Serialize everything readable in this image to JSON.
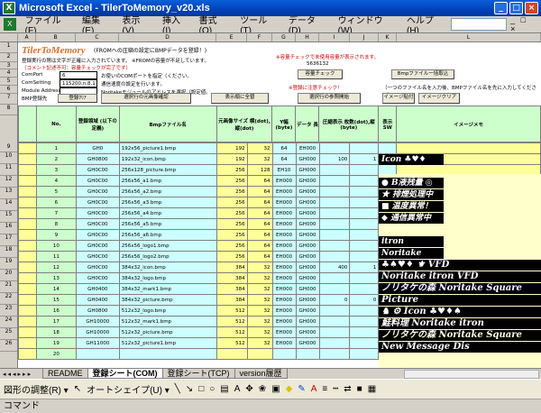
{
  "window": {
    "title": "Microsoft Excel - TilerToMemory_v20.xls",
    "app_icon": "excel-icon",
    "minimize": "_",
    "maximize": "□",
    "close": "×"
  },
  "menu": [
    "ファイル(F)",
    "編集(E)",
    "表示(V)",
    "挿入(I)",
    "書式(O)",
    "ツール(T)",
    "データ(D)",
    "ウィンドウ(W)",
    "ヘルプ(H)"
  ],
  "columns": [
    "",
    "A",
    "B",
    "C",
    "D",
    "E",
    "F",
    "G",
    "H",
    "I",
    "J",
    "K",
    "L"
  ],
  "rows": [
    "1",
    "2",
    "3",
    "4",
    "5",
    "6",
    "7",
    "8",
    "9",
    "10",
    "11",
    "12",
    "13",
    "14",
    "15",
    "16",
    "17",
    "18",
    "19",
    "20",
    "21",
    "22",
    "23",
    "24",
    "25",
    "26"
  ],
  "sheet": {
    "title": "TilerToMemory",
    "subtitle": "(FROMへの圧縮の設定にBMPデータを登録！)",
    "note1": "登録実行の際は文字が正確に入力されています。 ※FROMの容量が不足しています。",
    "note2": "（コメント記述不可：容量チェックが完了です）",
    "comport_label": "ComPort",
    "comport_value": "6",
    "comsetting_label": "ComSetting",
    "comsetting_value": "115200,n,8,1",
    "module_label": "Module Address",
    "module_value": "",
    "comport_desc": "お使いのCOMポートを指定（ください。",
    "comsetting_desc": "通信速度の設定を行います。",
    "module_desc": "Noritakeモジュールのアドレスを選択（設定値。",
    "capacity_note": "※容量チェックで未使用容量が表示されます。",
    "capacity_value": "5636132",
    "check_button": "容量チェック",
    "red_note": "※登録に注意チェック！",
    "bmp_folder_button": "Bmpファイル一括取込",
    "memo_note": "（一つのファイル名を入力後、BMPファイル名を先に入力してください）",
    "bmp_reg_label": "BMP登録先",
    "reg_button": "登録ｸﾘｱ",
    "chk_button": "選択行の元画像確認",
    "all_button": "表示順に全替",
    "enlarge_button": "選択行の参照開始",
    "image_attach_button": "イメージ貼付",
    "image_clear_button": "イメージクリア"
  },
  "table": {
    "headers": [
      "No.",
      "登録領域 (以下の定義)",
      "Bmpファイル名",
      "元画像サイズ 横(dot),縦(dot)",
      "Y幅 (byte)",
      "データ 長",
      "圧縮表示 枚数(dot),縦(byte)",
      "表示SW",
      "",
      "イメージメモ"
    ],
    "rows": [
      {
        "no": "1",
        "area": "GH0",
        "file": "192x56_picture1.bmp",
        "w": "192",
        "h": "32",
        "yb": "64",
        "len": "EH000",
        "c1": "",
        "c2": "",
        "c3": ""
      },
      {
        "no": "2",
        "area": "GH0800",
        "file": "192x32_icon.bmp",
        "w": "192",
        "h": "32",
        "yb": "64",
        "len": "GH000",
        "c1": "100",
        "c2": "1",
        "c3": ""
      },
      {
        "no": "3",
        "area": "GH0C00",
        "file": "256x128_picture.bmp",
        "w": "256",
        "h": "128",
        "yb": "EH10",
        "len": "GH000",
        "c1": "",
        "c2": "",
        "c3": ""
      },
      {
        "no": "4",
        "area": "GH0C00",
        "file": "256x56_a1.bmp",
        "w": "256",
        "h": "64",
        "yb": "EH000",
        "len": "GH000",
        "c1": "",
        "c2": "",
        "c3": ""
      },
      {
        "no": "5",
        "area": "GH0C00",
        "file": "256x56_a2.bmp",
        "w": "256",
        "h": "64",
        "yb": "EH000",
        "len": "GH000",
        "c1": "",
        "c2": "",
        "c3": ""
      },
      {
        "no": "6",
        "area": "GH0C00",
        "file": "256x56_a3.bmp",
        "w": "256",
        "h": "64",
        "yb": "EH000",
        "len": "GH000",
        "c1": "",
        "c2": "",
        "c3": ""
      },
      {
        "no": "7",
        "area": "GH0C00",
        "file": "256x56_a4.bmp",
        "w": "256",
        "h": "64",
        "yb": "EH000",
        "len": "GH000",
        "c1": "",
        "c2": "",
        "c3": ""
      },
      {
        "no": "8",
        "area": "GH0C00",
        "file": "256x56_a5.bmp",
        "w": "256",
        "h": "64",
        "yb": "EH000",
        "len": "GH000",
        "c1": "",
        "c2": "",
        "c3": ""
      },
      {
        "no": "9",
        "area": "GH0C00",
        "file": "256x56_a6.bmp",
        "w": "256",
        "h": "64",
        "yb": "EH000",
        "len": "GH000",
        "c1": "",
        "c2": "",
        "c3": ""
      },
      {
        "no": "10",
        "area": "GH0C00",
        "file": "256x56_logo1.bmp",
        "w": "256",
        "h": "64",
        "yb": "EH000",
        "len": "GH000",
        "c1": "",
        "c2": "",
        "c3": ""
      },
      {
        "no": "11",
        "area": "GH0C00",
        "file": "256x56_logo2.bmp",
        "w": "256",
        "h": "64",
        "yb": "EH000",
        "len": "GH000",
        "c1": "",
        "c2": "",
        "c3": ""
      },
      {
        "no": "12",
        "area": "GH0C00",
        "file": "384x32_icon.bmp",
        "w": "384",
        "h": "32",
        "yb": "EH000",
        "len": "GH000",
        "c1": "400",
        "c2": "1",
        "c3": ""
      },
      {
        "no": "13",
        "area": "GH0C00",
        "file": "384x32_logo.bmp",
        "w": "384",
        "h": "32",
        "yb": "EH000",
        "len": "GH000",
        "c1": "",
        "c2": "",
        "c3": ""
      },
      {
        "no": "14",
        "area": "GH0400",
        "file": "384x32_mark1.bmp",
        "w": "384",
        "h": "32",
        "yb": "EH000",
        "len": "GH000",
        "c1": "",
        "c2": "",
        "c3": ""
      },
      {
        "no": "15",
        "area": "GH0400",
        "file": "384x32_picture.bmp",
        "w": "384",
        "h": "32",
        "yb": "EH000",
        "len": "GH000",
        "c1": "0",
        "c2": "0",
        "c3": ""
      },
      {
        "no": "16",
        "area": "GH0800",
        "file": "512x32_logo.bmp",
        "w": "512",
        "h": "32",
        "yb": "EH000",
        "len": "GH000",
        "c1": "",
        "c2": "",
        "c3": ""
      },
      {
        "no": "17",
        "area": "GH10000",
        "file": "512x32_mark1.bmp",
        "w": "512",
        "h": "32",
        "yb": "EH000",
        "len": "GH000",
        "c1": "",
        "c2": "",
        "c3": ""
      },
      {
        "no": "18",
        "area": "GH10000",
        "file": "512x32_picture.bmp",
        "w": "512",
        "h": "32",
        "yb": "EH000",
        "len": "GH000",
        "c1": "",
        "c2": "",
        "c3": ""
      },
      {
        "no": "19",
        "area": "GH11000",
        "file": "512x32_picture1.bmp",
        "w": "512",
        "h": "32",
        "yb": "EH000",
        "len": "GH000",
        "c1": "",
        "c2": "",
        "c3": ""
      },
      {
        "no": "20",
        "area": "",
        "file": "",
        "w": "",
        "h": "",
        "yb": "",
        "len": "",
        "c1": "",
        "c2": "",
        "c3": ""
      }
    ],
    "side_note": "圧縮表示の有効可能な数を表示（マイナスは不可）",
    "side_note2": "表示数を入力(数値可)"
  },
  "memo_images": [
    {
      "text": ""
    },
    {
      "text": "Icon ♣♥♦"
    },
    {
      "text": ""
    },
    {
      "text": "● B液残量 ◎"
    },
    {
      "text": "★ 排煙処理中"
    },
    {
      "text": "■ 温度異常！"
    },
    {
      "text": "◆ 通信異常中"
    },
    {
      "text": ""
    },
    {
      "text": "itron"
    },
    {
      "text": "Noritake"
    },
    {
      "text": "♣♠♥♦ ⚜ VFD"
    },
    {
      "text": "Noritake itron VFD"
    },
    {
      "text": "ノリタケの森 Noritake Square"
    },
    {
      "text": "Picture"
    },
    {
      "text": "♞ ⚙ Icon ♣♥♦♠"
    },
    {
      "text": "鮭料理 Noritake itron"
    },
    {
      "text": "ノリタケの森 Noritake Square"
    },
    {
      "text": "New Message Dis"
    }
  ],
  "sheet_tabs": [
    "README",
    "登録シート(COM)",
    "登録シート(TCP)",
    "version履歴"
  ],
  "drawbar": {
    "draw_menu": "図形の調整(R) ▾",
    "autoshape": "オートシェイプ(U) ▾"
  },
  "status": "コマンド"
}
